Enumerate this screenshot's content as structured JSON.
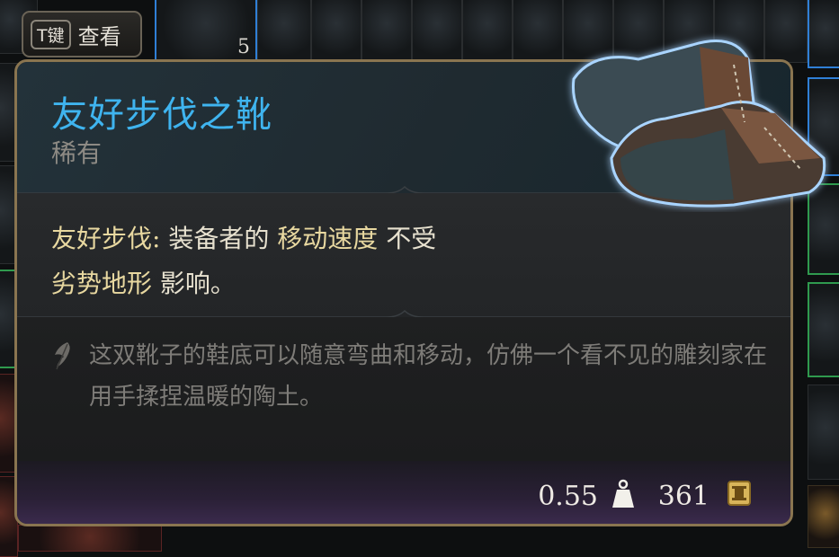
{
  "hint": {
    "key": "T键",
    "label": "查看"
  },
  "inventory": {
    "stack_count": "5"
  },
  "item": {
    "name": "友好步伐之靴",
    "rarity": "稀有",
    "effect_name": "友好步伐:",
    "effect_part1": "装备者的",
    "effect_keyword": "移动速度",
    "effect_part2": "不受",
    "effect_line2_keyword": "劣势地形",
    "effect_line2_rest": "影响。",
    "lore": "这双靴子的鞋底可以随意弯曲和移动，仿佛一个看不见的雕刻家在用手揉捏温暖的陶土。",
    "weight": "0.55",
    "price": "361"
  },
  "colors": {
    "name": "#3fb4ef",
    "rarity": "#8d8a84",
    "border": "#8a7550",
    "effect_text": "#e7e1cf"
  },
  "icons": {
    "weight": "weight-icon",
    "gold": "gold-coin-icon",
    "lore": "feather-icon",
    "item": "boots-icon"
  }
}
